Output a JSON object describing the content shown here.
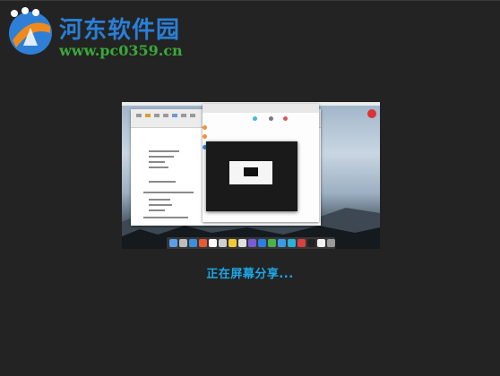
{
  "watermark": {
    "title": "河东软件园",
    "url": "www.pc0359.cn",
    "colors": {
      "title": "#2a7fd8",
      "url": "#3aa83a",
      "logo_blue": "#2f7fd6",
      "logo_orange": "#f08a1d"
    }
  },
  "preview": {
    "description_icon": "screen-share-thumbnail",
    "dock_colors": [
      "#5aa0e8",
      "#bdbdbd",
      "#3c8fdf",
      "#e85a30",
      "#ffffff",
      "#cfcfcf",
      "#f4c830",
      "#e0e0e0",
      "#7a5cd8",
      "#2e7de0",
      "#49b24a",
      "#3b9ae8",
      "#2bb0d8",
      "#d94040",
      "#222222",
      "#f3f3f3",
      "#9a9a9a"
    ]
  },
  "status": {
    "text": "正在屏幕分享...",
    "color": "#1ea7e6"
  }
}
